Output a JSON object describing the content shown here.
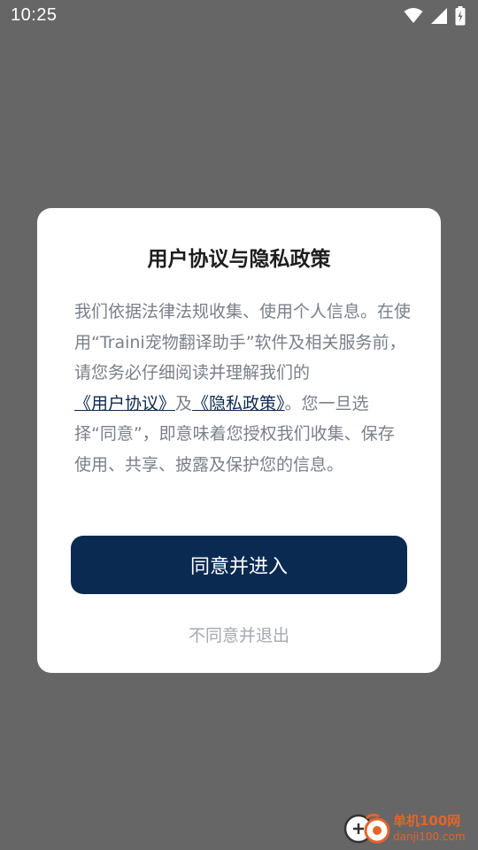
{
  "status_bar": {
    "time": "10:25",
    "icons": [
      "wifi-icon",
      "cellular-signal-icon",
      "battery-charging-icon"
    ]
  },
  "dialog": {
    "title": "用户协议与隐私政策",
    "body_part1": "我们依据法律法规收集、使用个人信息。在使用“Traini宠物翻译助手”软件及相关服务前，请您务必仔细阅读并理解我们的",
    "user_agreement_link": "《用户协议》",
    "connector": "及",
    "privacy_policy_link": "《隐私政策》",
    "body_part2": "。您一旦选择“同意”，即意味着您授权我们收集、保存使用、共享、披露及保护您的信息。",
    "agree_button": "同意并进入",
    "disagree_link": "不同意并退出"
  },
  "watermark": {
    "name": "单机100网",
    "url": "danji100.com"
  },
  "colors": {
    "overlay": "#666666",
    "dialog_bg": "#ffffff",
    "primary": "#0b2a52",
    "body_text": "#7a7f8a",
    "link": "#0d2a4e",
    "muted": "#a5a9b1",
    "watermark": "#e2652a"
  }
}
